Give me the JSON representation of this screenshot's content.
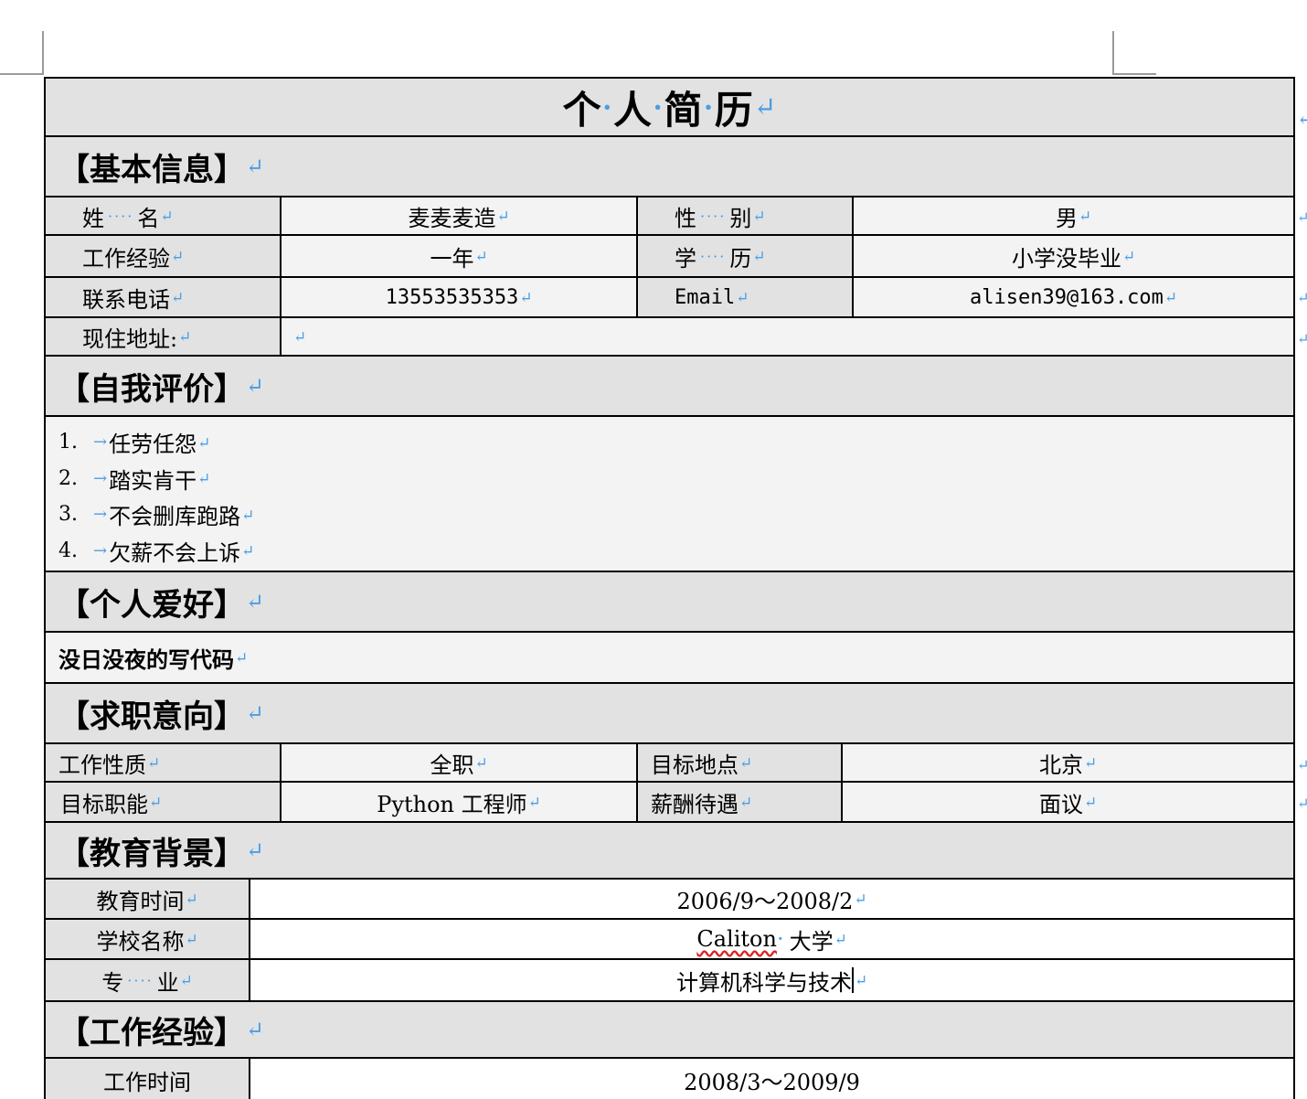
{
  "title": "个·人·简·历",
  "title_chars": [
    "个",
    "人",
    "简",
    "历"
  ],
  "return_mark": "↵",
  "tab_mark": "→",
  "sections": {
    "basic": "【基本信息】",
    "self_eval": "【自我评价】",
    "hobby": "【个人爱好】",
    "intent": "【求职意向】",
    "education": "【教育背景】",
    "work": "【工作经验】"
  },
  "basic_info": {
    "name_label_a": "姓",
    "name_label_b": "名",
    "name_value": "麦麦麦造",
    "gender_label_a": "性",
    "gender_label_b": "别",
    "gender_value": "男",
    "experience_label": "工作经验",
    "experience_value": "一年",
    "degree_label_a": "学",
    "degree_label_b": "历",
    "degree_value": "小学没毕业",
    "phone_label": "联系电话",
    "phone_value": "13553535353",
    "email_label": "Email",
    "email_value": "alisen39@163.com",
    "address_label": "现住地址:",
    "address_value": ""
  },
  "self_evaluation": [
    {
      "num": "1.",
      "text": "任劳任怨"
    },
    {
      "num": "2.",
      "text": "踏实肯干"
    },
    {
      "num": "3.",
      "text": "不会删库跑路"
    },
    {
      "num": "4.",
      "text": "欠薪不会上诉"
    }
  ],
  "hobby": "没日没夜的写代码",
  "job_intent": {
    "nature_label": "工作性质",
    "nature_value": "全职",
    "location_label": "目标地点",
    "location_value": "北京",
    "function_label": "目标职能",
    "function_value": "Python 工程师",
    "salary_label": "薪酬待遇",
    "salary_value": "面议"
  },
  "education": {
    "time_label": "教育时间",
    "time_value": "2006/9～2008/2",
    "school_label": "学校名称",
    "school_value_a": "Caliton",
    "school_value_b": "大学",
    "major_label_a": "专",
    "major_label_b": "业",
    "major_value": "计算机科学与技术"
  },
  "work": {
    "time_label": "工作时间",
    "time_value": "2008/3～2009/9"
  }
}
